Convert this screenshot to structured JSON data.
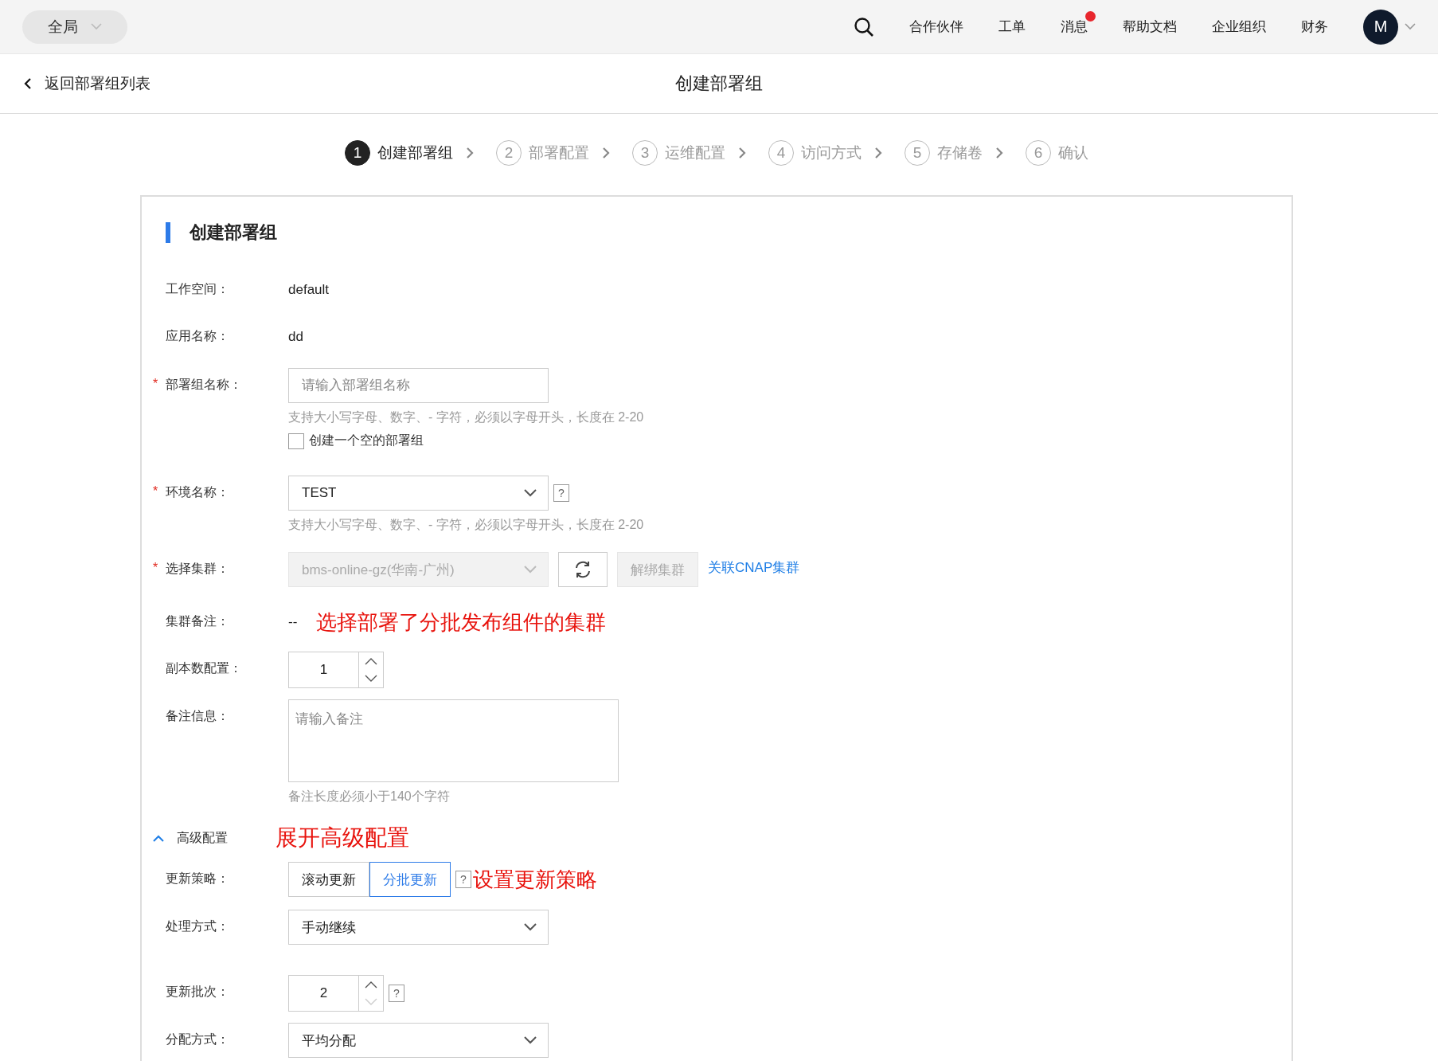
{
  "top_bar": {
    "scope": "全局",
    "nav": [
      {
        "label": "合作伙伴",
        "badge": false
      },
      {
        "label": "工单",
        "badge": false
      },
      {
        "label": "消息",
        "badge": true
      },
      {
        "label": "帮助文档",
        "badge": false
      },
      {
        "label": "企业组织",
        "badge": false
      },
      {
        "label": "财务",
        "badge": false
      }
    ],
    "avatar": "M"
  },
  "header": {
    "back": "返回部署组列表",
    "title": "创建部署组"
  },
  "steps": [
    {
      "number": "1",
      "label": "创建部署组",
      "selected": true
    },
    {
      "number": "2",
      "label": "部署配置",
      "selected": false
    },
    {
      "number": "3",
      "label": "运维配置",
      "selected": false
    },
    {
      "number": "4",
      "label": "访问方式",
      "selected": false
    },
    {
      "number": "5",
      "label": "存储卷",
      "selected": false
    },
    {
      "number": "6",
      "label": "确认",
      "selected": false
    }
  ],
  "section_title": "创建部署组",
  "fields": [
    {
      "kind": "text",
      "label": "工作空间：",
      "value": "default"
    },
    {
      "kind": "text",
      "label": "应用名称：",
      "value": "dd"
    },
    {
      "kind": "input",
      "label": "部署组名称：",
      "required_mark": "*",
      "placeholder": "请输入部署组名称",
      "hint": "支持大小写字母、数字、- 字符，必须以字母开头，长度在 2-20",
      "checkbox": {
        "label": "创建一个空的部署组",
        "checked": false
      }
    },
    {
      "kind": "select",
      "label": "环境名称：",
      "required_mark": "*",
      "value": "TEST",
      "help": "?",
      "disabled": false,
      "hint": "支持大小写字母、数字、- 字符，必须以字母开头，长度在 2-20"
    },
    {
      "kind": "cluster",
      "label": "选择集群：",
      "required_mark": "*",
      "value": "bms-online-gz(华南-广州)",
      "disabled": true,
      "unbind": "解绑集群",
      "link": "关联CNAP集群"
    },
    {
      "kind": "text",
      "label": "集群备注：",
      "value": "--",
      "annotation": "选择部署了分批发布组件的集群"
    },
    {
      "kind": "number",
      "label": "副本数配置：",
      "value": "1",
      "down_disabled": false
    },
    {
      "kind": "textarea",
      "label": "备注信息：",
      "placeholder": "请输入备注",
      "hint": "备注长度必须小于140个字符"
    }
  ],
  "advanced": {
    "label": "高级配置",
    "expanded": true,
    "annotation": "展开高级配置"
  },
  "advanced_fields": [
    {
      "kind": "segmented",
      "label": "更新策略：",
      "options": [
        {
          "label": "滚动更新",
          "selected": false
        },
        {
          "label": "分批更新",
          "selected": true
        }
      ],
      "help": "?",
      "annotation": "设置更新策略"
    },
    {
      "kind": "select",
      "label": "处理方式：",
      "value": "手动继续",
      "disabled": false
    },
    {
      "kind": "number",
      "label": "更新批次：",
      "value": "2",
      "down_disabled": true,
      "help": "?"
    },
    {
      "kind": "select",
      "label": "分配方式：",
      "value": "平均分配",
      "disabled": false
    }
  ]
}
